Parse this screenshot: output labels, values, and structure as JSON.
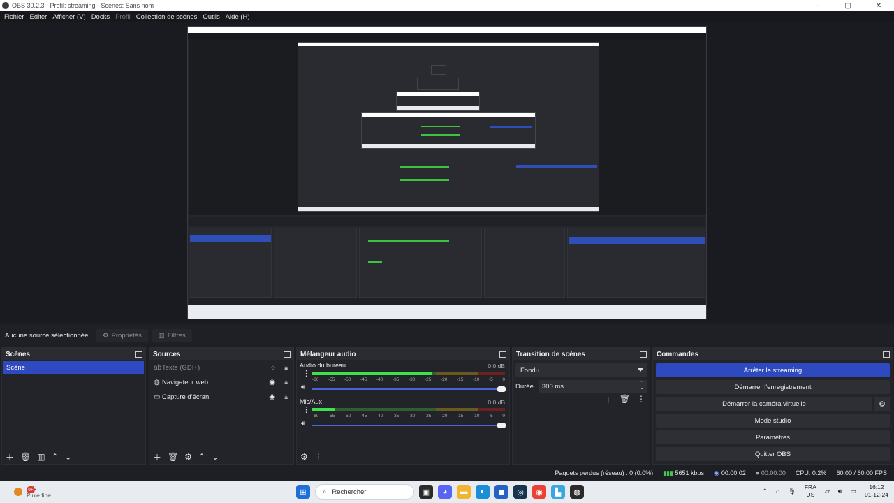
{
  "window": {
    "title": "OBS 30.2.3 - Profil: streaming - Scènes: Sans nom",
    "controls": [
      "–",
      "▢",
      "✕"
    ]
  },
  "menu": [
    "Fichier",
    "Editer",
    "Afficher (V)",
    "Docks",
    "Profil",
    "Collection de scènes",
    "Outils",
    "Aide (H)"
  ],
  "source_toolbar": {
    "no_source": "Aucune source sélectionnée",
    "properties": "Propriétés",
    "filters": "Filtres"
  },
  "scenes": {
    "title": "Scènes",
    "items": [
      "Scène"
    ]
  },
  "sources": {
    "title": "Sources",
    "items": [
      "Texte (GDI+)",
      "Navigateur web",
      "Capture d'écran"
    ]
  },
  "mixer": {
    "title": "Mélangeur audio",
    "channels": [
      {
        "name": "Audio du bureau",
        "db": "0.0 dB",
        "level": 0.62
      },
      {
        "name": "Mic/Aux",
        "db": "0.0 dB",
        "level": 0.12
      }
    ],
    "ticks": [
      "-60",
      "-55",
      "-50",
      "-45",
      "-40",
      "-35",
      "-30",
      "-25",
      "-20",
      "-15",
      "-10",
      "-5",
      "0"
    ]
  },
  "transitions": {
    "title": "Transition de scènes",
    "selected": "Fondu",
    "duration_label": "Durée",
    "duration_value": "300 ms"
  },
  "commands": {
    "title": "Commandes",
    "stop_stream": "Arrêter le streaming",
    "start_record": "Démarrer l'enregistrement",
    "virtual_cam": "Démarrer la caméra virtuelle",
    "studio_mode": "Mode studio",
    "settings": "Paramètres",
    "quit": "Quitter OBS"
  },
  "status": {
    "dropped": "Paquets perdus (réseau) : 0 (0.0%)",
    "bitrate": "5651 kbps",
    "stream_time": "00:00:02",
    "record_time": "00:00:00",
    "cpu": "CPU: 0.2%",
    "fps": "60.00 / 60.00 FPS"
  },
  "taskbar": {
    "weather_temp": "7°C",
    "weather_desc": "Pluie fine",
    "weather_badge": "9+",
    "search": "Rechercher",
    "lang1": "FRA",
    "lang2": "US",
    "time": "16:12",
    "date": "01-12-24"
  }
}
